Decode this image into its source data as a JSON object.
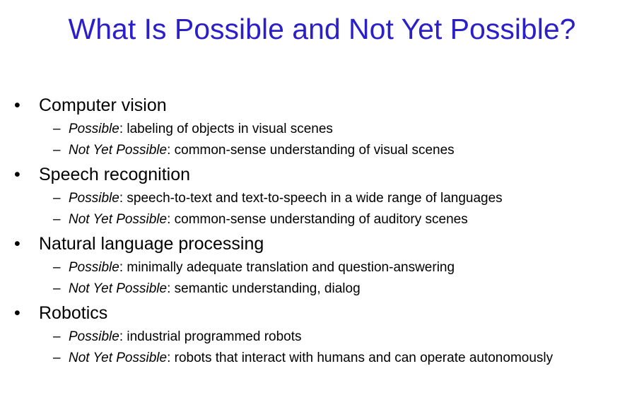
{
  "title": "What Is Possible and Not Yet Possible?",
  "bullet_symbol": "•",
  "dash_symbol": "–",
  "sections": [
    {
      "heading": "Computer vision",
      "possible_label": "Possible",
      "possible_text": ":  labeling of objects in visual scenes",
      "not_yet_label": "Not Yet Possible",
      "not_yet_text": ": common-sense understanding of visual scenes"
    },
    {
      "heading": "Speech recognition",
      "possible_label": "Possible",
      "possible_text": ": speech-to-text and text-to-speech in a wide range of languages",
      "not_yet_label": "Not Yet Possible",
      "not_yet_text": ": common-sense understanding of auditory scenes"
    },
    {
      "heading": "Natural language processing",
      "possible_label": "Possible",
      "possible_text": ": minimally adequate translation and question-answering",
      "not_yet_label": "Not Yet Possible",
      "not_yet_text": ": semantic understanding, dialog"
    },
    {
      "heading": "Robotics",
      "possible_label": "Possible",
      "possible_text": ": industrial programmed robots",
      "not_yet_label": "Not Yet Possible",
      "not_yet_text": ": robots that interact with humans and can operate autonomously"
    }
  ],
  "colors": {
    "title": "#2b1fc9",
    "text": "#000000",
    "background": "#ffffff"
  }
}
